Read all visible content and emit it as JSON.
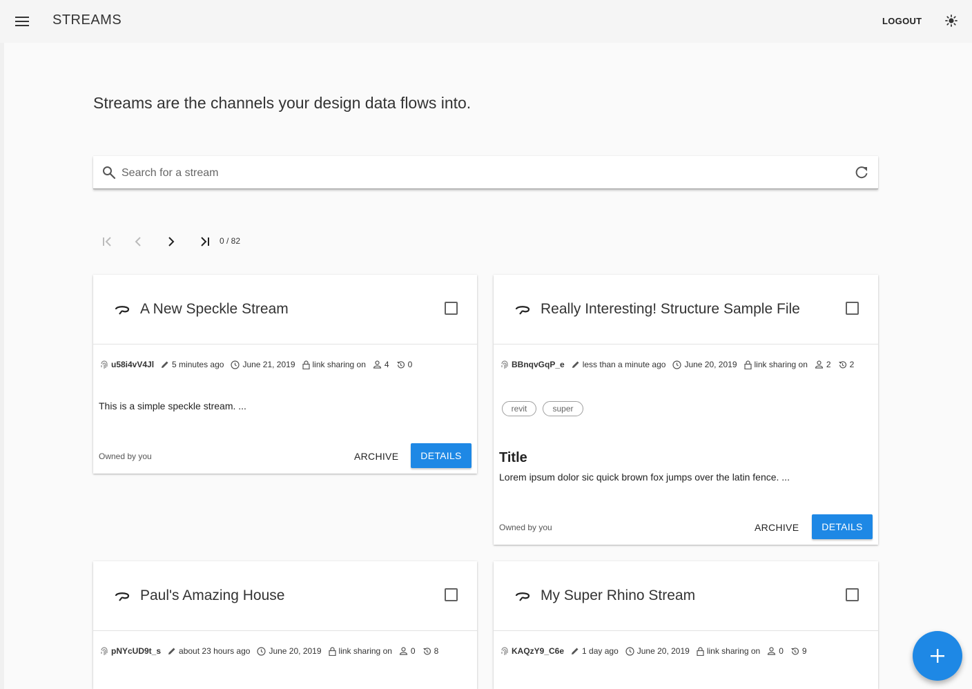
{
  "app": {
    "title": "STREAMS",
    "logout_label": "LOGOUT"
  },
  "intro": "Streams are the channels your design data flows into.",
  "search": {
    "placeholder": "Search for a stream",
    "value": ""
  },
  "pager": {
    "count": "0 / 82"
  },
  "colors": {
    "accent": "#1e88e5",
    "appbar": "#f5f5f5"
  },
  "icons": {
    "menu": "menu-icon",
    "theme": "brightness-icon",
    "search": "magnify-icon",
    "refresh": "refresh-icon",
    "first": "page-first-icon",
    "prev": "chevron-left-icon",
    "next": "chevron-right-icon",
    "last": "page-last-icon",
    "stream": "stream-icon",
    "id": "fingerprint-icon",
    "edited": "pencil-icon",
    "created": "clock-icon",
    "sharing": "lock-icon",
    "users": "account-icon",
    "history": "history-icon",
    "add": "plus-icon"
  },
  "streams": [
    {
      "title": "A New Speckle Stream",
      "id": "u58i4vV4Jl",
      "edited": "5 minutes ago",
      "created": "June 21, 2019",
      "sharing": "link sharing on",
      "users": "4",
      "history": "0",
      "tags": [],
      "heading": "",
      "description": "This is a simple speckle stream. ...",
      "owner": "Owned by you",
      "archive_label": "ARCHIVE",
      "details_label": "DETAILS"
    },
    {
      "title": "Really Interesting! Structure Sample File",
      "id": "BBnqvGqP_e",
      "edited": "less than a minute ago",
      "created": "June 20, 2019",
      "sharing": "link sharing on",
      "users": "2",
      "history": "2",
      "tags": [
        "revit",
        "super"
      ],
      "heading": "Title",
      "description": "Lorem ipsum dolor sic quick brown fox jumps over the latin fence. ...",
      "owner": "Owned by you",
      "archive_label": "ARCHIVE",
      "details_label": "DETAILS"
    },
    {
      "title": "Paul's Amazing House",
      "id": "pNYcUD9t_s",
      "edited": "about 23 hours ago",
      "created": "June 20, 2019",
      "sharing": "link sharing on",
      "users": "0",
      "history": "8"
    },
    {
      "title": "My Super Rhino Stream",
      "id": "KAQzY9_C6e",
      "edited": "1 day ago",
      "created": "June 20, 2019",
      "sharing": "link sharing on",
      "users": "0",
      "history": "9"
    }
  ]
}
